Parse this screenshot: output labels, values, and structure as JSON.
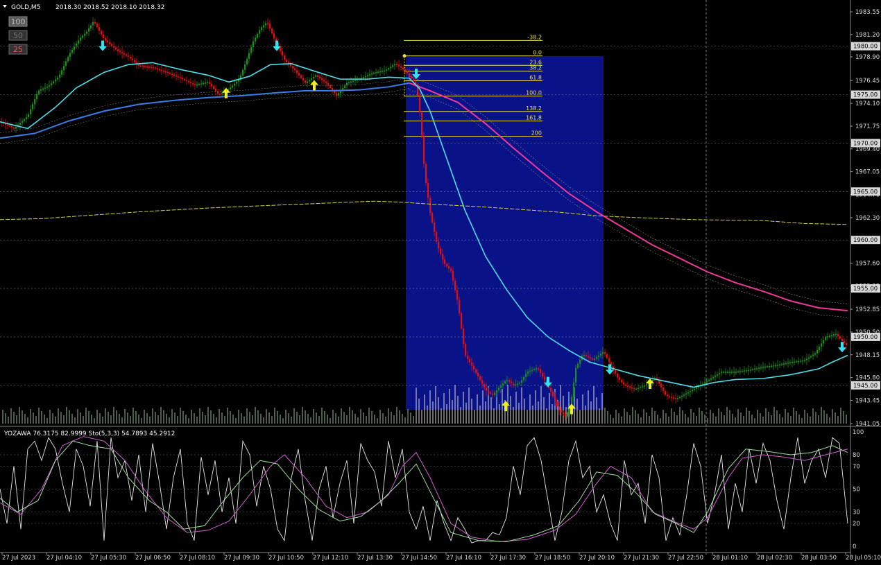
{
  "header": {
    "symbol": "GOLD,M5",
    "ohlc": "2018.30 2018.52 2018.10 2018.32"
  },
  "buttons": [
    "100",
    "50",
    "25"
  ],
  "colors": {
    "background": "#000000",
    "bull": "#1e8c1e",
    "bear": "#e01010",
    "ma_cyan": "#4fe0ee",
    "ma_blue": "#3a7ee8",
    "ma_pink": "#ee3a9a",
    "fib": "#f0e040",
    "rect": "#0a1288",
    "arrow_down": "#32e4f0",
    "arrow_up": "#f0f020",
    "grid": "#c8c8c8",
    "volume": "#9ab89a"
  },
  "price_axis": {
    "labels": [
      "1983.55",
      "1981.20",
      "1978.90",
      "1976.45",
      "1974.10",
      "1971.75",
      "1969.40",
      "1967.05",
      "1964.70",
      "1962.30",
      "1957.60",
      "1955.25",
      "1952.85",
      "1950.50",
      "1948.15",
      "1945.80",
      "1943.45",
      "1941.05"
    ],
    "marked_levels": [
      "1980.00",
      "1975.00",
      "1970.00",
      "1965.00",
      "1960.00",
      "1955.00",
      "1950.00",
      "1945.00"
    ]
  },
  "time_axis": [
    "27 Jul 2023",
    "27 Jul 04:10",
    "27 Jul 05:30",
    "27 Jul 06:50",
    "27 Jul 08:10",
    "27 Jul 09:30",
    "27 Jul 10:50",
    "27 Jul 12:10",
    "27 Jul 13:30",
    "27 Jul 14:50",
    "27 Jul 16:10",
    "27 Jul 17:30",
    "27 Jul 18:50",
    "27 Jul 20:10",
    "27 Jul 21:30",
    "27 Jul 22:50",
    "28 Jul 01:10",
    "28 Jul 02:30",
    "28 Jul 03:50",
    "28 Jul 05:10"
  ],
  "fibonacci": {
    "high": 1979.0,
    "low": 1974.85,
    "levels": [
      "-38.2",
      "0.0",
      "23.6",
      "38.2",
      "61.8",
      "100.0",
      "138.2",
      "161.8",
      "200"
    ]
  },
  "indicator": {
    "title": "YOZAWA 76.3175 82.9999  Sto(5,3,3) 54.7893 45.2912",
    "axis_labels": [
      "100",
      "80",
      "70",
      "50",
      "30",
      "20",
      "0"
    ]
  },
  "chart_data": {
    "type": "candlestick",
    "title": "GOLD,M5",
    "y_range": [
      1940.5,
      1985.0
    ],
    "indicator_range": [
      0,
      100
    ],
    "price_path": [
      [
        0,
        1972.2
      ],
      [
        20,
        1971.5
      ],
      [
        40,
        1972.8
      ],
      [
        55,
        1975.4
      ],
      [
        70,
        1975.9
      ],
      [
        85,
        1976.9
      ],
      [
        100,
        1979.2
      ],
      [
        115,
        1980.8
      ],
      [
        125,
        1981.5
      ],
      [
        135,
        1982.6
      ],
      [
        150,
        1980.7
      ],
      [
        170,
        1979.5
      ],
      [
        185,
        1978.9
      ],
      [
        200,
        1978.0
      ],
      [
        220,
        1977.8
      ],
      [
        240,
        1977.3
      ],
      [
        260,
        1976.7
      ],
      [
        280,
        1976.0
      ],
      [
        300,
        1976.3
      ],
      [
        315,
        1975.0
      ],
      [
        330,
        1975.6
      ],
      [
        345,
        1976.6
      ],
      [
        355,
        1978.5
      ],
      [
        365,
        1980.5
      ],
      [
        375,
        1981.8
      ],
      [
        385,
        1982.5
      ],
      [
        395,
        1980.8
      ],
      [
        410,
        1978.6
      ],
      [
        425,
        1977.5
      ],
      [
        440,
        1976.2
      ],
      [
        455,
        1977.0
      ],
      [
        470,
        1976.2
      ],
      [
        485,
        1974.9
      ],
      [
        500,
        1976.2
      ],
      [
        520,
        1976.7
      ],
      [
        540,
        1977.3
      ],
      [
        555,
        1977.5
      ],
      [
        570,
        1978.2
      ],
      [
        585,
        1977.4
      ],
      [
        600,
        1976.0
      ],
      [
        606,
        1972.6
      ],
      [
        612,
        1966.9
      ],
      [
        620,
        1962.8
      ],
      [
        630,
        1959.5
      ],
      [
        640,
        1957.6
      ],
      [
        650,
        1956.8
      ],
      [
        660,
        1953.5
      ],
      [
        670,
        1948.2
      ],
      [
        680,
        1947.0
      ],
      [
        690,
        1945.8
      ],
      [
        700,
        1944.5
      ],
      [
        710,
        1944.0
      ],
      [
        720,
        1944.8
      ],
      [
        730,
        1945.6
      ],
      [
        740,
        1945.0
      ],
      [
        750,
        1945.3
      ],
      [
        760,
        1946.4
      ],
      [
        775,
        1946.8
      ],
      [
        785,
        1945.5
      ],
      [
        795,
        1944.2
      ],
      [
        805,
        1942.5
      ],
      [
        815,
        1941.8
      ],
      [
        822,
        1942.8
      ],
      [
        830,
        1946.8
      ],
      [
        840,
        1948.2
      ],
      [
        855,
        1947.6
      ],
      [
        870,
        1948.5
      ],
      [
        880,
        1947.1
      ],
      [
        890,
        1945.8
      ],
      [
        900,
        1945.0
      ],
      [
        915,
        1944.6
      ],
      [
        930,
        1945.0
      ],
      [
        945,
        1945.8
      ],
      [
        960,
        1943.9
      ],
      [
        975,
        1943.6
      ],
      [
        990,
        1944.2
      ],
      [
        1005,
        1944.8
      ],
      [
        1020,
        1945.5
      ],
      [
        1040,
        1946.4
      ],
      [
        1060,
        1946.4
      ],
      [
        1080,
        1946.6
      ],
      [
        1100,
        1946.9
      ],
      [
        1120,
        1947.1
      ],
      [
        1140,
        1947.4
      ],
      [
        1160,
        1947.6
      ],
      [
        1175,
        1948.3
      ],
      [
        1190,
        1950.0
      ],
      [
        1205,
        1950.3
      ],
      [
        1215,
        1949.5
      ],
      [
        1222,
        1949.0
      ]
    ],
    "ma_fast_cyan": [
      [
        0,
        1972.2
      ],
      [
        40,
        1971.5
      ],
      [
        80,
        1973.7
      ],
      [
        110,
        1975.7
      ],
      [
        150,
        1977.3
      ],
      [
        185,
        1978.1
      ],
      [
        220,
        1978.3
      ],
      [
        260,
        1977.6
      ],
      [
        300,
        1977.0
      ],
      [
        330,
        1976.3
      ],
      [
        360,
        1976.9
      ],
      [
        390,
        1978.1
      ],
      [
        420,
        1978.2
      ],
      [
        450,
        1977.5
      ],
      [
        490,
        1976.6
      ],
      [
        530,
        1976.6
      ],
      [
        560,
        1976.8
      ],
      [
        590,
        1976.7
      ],
      [
        605,
        1975.6
      ],
      [
        620,
        1973.3
      ],
      [
        645,
        1968.2
      ],
      [
        670,
        1963.1
      ],
      [
        700,
        1958.3
      ],
      [
        730,
        1954.9
      ],
      [
        760,
        1952.0
      ],
      [
        790,
        1950.0
      ],
      [
        820,
        1948.6
      ],
      [
        850,
        1947.4
      ],
      [
        880,
        1946.8
      ],
      [
        920,
        1946.0
      ],
      [
        960,
        1945.4
      ],
      [
        1000,
        1944.8
      ],
      [
        1030,
        1945.3
      ],
      [
        1060,
        1945.6
      ],
      [
        1100,
        1945.7
      ],
      [
        1140,
        1946.1
      ],
      [
        1180,
        1946.7
      ],
      [
        1200,
        1947.4
      ],
      [
        1222,
        1948.1
      ]
    ],
    "ma_slow_blue": [
      [
        0,
        1970.5
      ],
      [
        50,
        1971.0
      ],
      [
        100,
        1972.3
      ],
      [
        150,
        1973.3
      ],
      [
        200,
        1974.0
      ],
      [
        250,
        1974.4
      ],
      [
        300,
        1974.7
      ],
      [
        350,
        1974.9
      ],
      [
        400,
        1975.2
      ],
      [
        440,
        1975.4
      ],
      [
        480,
        1975.4
      ],
      [
        520,
        1975.5
      ],
      [
        560,
        1975.8
      ],
      [
        590,
        1976.2
      ]
    ],
    "ma_pink": [
      [
        590,
        1976.2
      ],
      [
        620,
        1975.4
      ],
      [
        660,
        1974.2
      ],
      [
        700,
        1972.0
      ],
      [
        740,
        1969.5
      ],
      [
        780,
        1967.1
      ],
      [
        820,
        1964.8
      ],
      [
        860,
        1962.9
      ],
      [
        900,
        1961.2
      ],
      [
        940,
        1959.5
      ],
      [
        980,
        1958.1
      ],
      [
        1020,
        1956.7
      ],
      [
        1060,
        1955.6
      ],
      [
        1100,
        1954.7
      ],
      [
        1140,
        1953.7
      ],
      [
        1180,
        1953.0
      ],
      [
        1222,
        1952.7
      ]
    ],
    "ma_yellow_dashed": [
      [
        0,
        1962.1
      ],
      [
        60,
        1962.2
      ],
      [
        120,
        1962.5
      ],
      [
        200,
        1962.9
      ],
      [
        300,
        1963.3
      ],
      [
        400,
        1963.6
      ],
      [
        470,
        1963.8
      ],
      [
        500,
        1963.9
      ],
      [
        540,
        1964.0
      ],
      [
        580,
        1963.9
      ],
      [
        620,
        1963.7
      ],
      [
        700,
        1963.4
      ],
      [
        760,
        1963.1
      ],
      [
        800,
        1962.9
      ],
      [
        860,
        1962.5
      ],
      [
        920,
        1962.3
      ],
      [
        1000,
        1962.1
      ],
      [
        1100,
        1962.0
      ],
      [
        1160,
        1961.7
      ],
      [
        1222,
        1961.6
      ]
    ],
    "arrows_down": [
      [
        148,
        1980.0
      ],
      [
        399,
        1980.0
      ],
      [
        600,
        1977.1
      ],
      [
        790,
        1945.3
      ],
      [
        879,
        1946.6
      ],
      [
        1214,
        1948.9
      ]
    ],
    "arrows_up": [
      [
        326,
        1975.2
      ],
      [
        453,
        1976.0
      ],
      [
        729,
        1942.9
      ],
      [
        824,
        1942.6
      ],
      [
        937,
        1945.2
      ]
    ],
    "stoch_pink": [
      [
        0,
        38
      ],
      [
        30,
        28
      ],
      [
        60,
        50
      ],
      [
        90,
        88
      ],
      [
        120,
        96
      ],
      [
        150,
        92
      ],
      [
        180,
        75
      ],
      [
        210,
        48
      ],
      [
        240,
        25
      ],
      [
        270,
        12
      ],
      [
        300,
        14
      ],
      [
        330,
        22
      ],
      [
        360,
        45
      ],
      [
        390,
        70
      ],
      [
        410,
        80
      ],
      [
        440,
        60
      ],
      [
        470,
        35
      ],
      [
        500,
        25
      ],
      [
        530,
        30
      ],
      [
        560,
        45
      ],
      [
        580,
        70
      ],
      [
        600,
        82
      ],
      [
        620,
        60
      ],
      [
        650,
        20
      ],
      [
        680,
        8
      ],
      [
        720,
        4
      ],
      [
        760,
        6
      ],
      [
        800,
        14
      ],
      [
        830,
        28
      ],
      [
        860,
        55
      ],
      [
        880,
        70
      ],
      [
        910,
        60
      ],
      [
        940,
        30
      ],
      [
        970,
        22
      ],
      [
        1000,
        15
      ],
      [
        1020,
        25
      ],
      [
        1050,
        60
      ],
      [
        1070,
        77
      ],
      [
        1100,
        80
      ],
      [
        1130,
        78
      ],
      [
        1160,
        75
      ],
      [
        1190,
        80
      ],
      [
        1222,
        85
      ]
    ],
    "stoch_green": [
      [
        0,
        42
      ],
      [
        25,
        30
      ],
      [
        55,
        40
      ],
      [
        80,
        75
      ],
      [
        105,
        92
      ],
      [
        130,
        88
      ],
      [
        160,
        85
      ],
      [
        185,
        60
      ],
      [
        215,
        40
      ],
      [
        240,
        30
      ],
      [
        265,
        15
      ],
      [
        295,
        18
      ],
      [
        320,
        38
      ],
      [
        350,
        60
      ],
      [
        375,
        75
      ],
      [
        400,
        72
      ],
      [
        430,
        50
      ],
      [
        460,
        32
      ],
      [
        490,
        22
      ],
      [
        520,
        26
      ],
      [
        550,
        40
      ],
      [
        575,
        55
      ],
      [
        600,
        72
      ],
      [
        620,
        48
      ],
      [
        650,
        12
      ],
      [
        690,
        5
      ],
      [
        730,
        4
      ],
      [
        770,
        10
      ],
      [
        805,
        18
      ],
      [
        835,
        40
      ],
      [
        860,
        65
      ],
      [
        890,
        62
      ],
      [
        915,
        48
      ],
      [
        945,
        28
      ],
      [
        975,
        20
      ],
      [
        1000,
        12
      ],
      [
        1020,
        30
      ],
      [
        1050,
        68
      ],
      [
        1075,
        85
      ],
      [
        1105,
        83
      ],
      [
        1140,
        80
      ],
      [
        1170,
        82
      ],
      [
        1200,
        88
      ],
      [
        1222,
        82
      ]
    ],
    "yozawa_white": [
      [
        0,
        50
      ],
      [
        10,
        20
      ],
      [
        20,
        70
      ],
      [
        30,
        15
      ],
      [
        40,
        85
      ],
      [
        50,
        92
      ],
      [
        60,
        75
      ],
      [
        70,
        95
      ],
      [
        80,
        85
      ],
      [
        90,
        55
      ],
      [
        100,
        30
      ],
      [
        110,
        85
      ],
      [
        120,
        70
      ],
      [
        130,
        35
      ],
      [
        140,
        92
      ],
      [
        150,
        5
      ],
      [
        160,
        95
      ],
      [
        170,
        60
      ],
      [
        180,
        75
      ],
      [
        190,
        40
      ],
      [
        200,
        80
      ],
      [
        210,
        30
      ],
      [
        220,
        90
      ],
      [
        230,
        55
      ],
      [
        240,
        15
      ],
      [
        250,
        60
      ],
      [
        260,
        85
      ],
      [
        270,
        20
      ],
      [
        280,
        5
      ],
      [
        290,
        78
      ],
      [
        300,
        45
      ],
      [
        310,
        75
      ],
      [
        320,
        30
      ],
      [
        330,
        60
      ],
      [
        340,
        20
      ],
      [
        350,
        92
      ],
      [
        360,
        80
      ],
      [
        370,
        35
      ],
      [
        380,
        70
      ],
      [
        390,
        50
      ],
      [
        400,
        15
      ],
      [
        410,
        5
      ],
      [
        420,
        60
      ],
      [
        430,
        85
      ],
      [
        440,
        40
      ],
      [
        450,
        5
      ],
      [
        460,
        50
      ],
      [
        470,
        70
      ],
      [
        480,
        25
      ],
      [
        490,
        55
      ],
      [
        500,
        75
      ],
      [
        510,
        20
      ],
      [
        520,
        90
      ],
      [
        530,
        75
      ],
      [
        540,
        65
      ],
      [
        550,
        35
      ],
      [
        560,
        92
      ],
      [
        570,
        60
      ],
      [
        580,
        85
      ],
      [
        590,
        30
      ],
      [
        600,
        15
      ],
      [
        610,
        35
      ],
      [
        620,
        5
      ],
      [
        630,
        40
      ],
      [
        640,
        20
      ],
      [
        650,
        5
      ],
      [
        660,
        25
      ],
      [
        670,
        15
      ],
      [
        680,
        3
      ],
      [
        690,
        5
      ],
      [
        700,
        5
      ],
      [
        710,
        12
      ],
      [
        720,
        10
      ],
      [
        730,
        25
      ],
      [
        740,
        70
      ],
      [
        750,
        45
      ],
      [
        760,
        88
      ],
      [
        770,
        95
      ],
      [
        780,
        75
      ],
      [
        790,
        40
      ],
      [
        800,
        5
      ],
      [
        810,
        30
      ],
      [
        820,
        75
      ],
      [
        830,
        92
      ],
      [
        840,
        60
      ],
      [
        850,
        70
      ],
      [
        860,
        30
      ],
      [
        870,
        45
      ],
      [
        880,
        20
      ],
      [
        890,
        5
      ],
      [
        900,
        75
      ],
      [
        910,
        45
      ],
      [
        920,
        55
      ],
      [
        930,
        20
      ],
      [
        940,
        80
      ],
      [
        950,
        60
      ],
      [
        960,
        5
      ],
      [
        970,
        25
      ],
      [
        980,
        10
      ],
      [
        990,
        45
      ],
      [
        1000,
        90
      ],
      [
        1010,
        70
      ],
      [
        1020,
        20
      ],
      [
        1030,
        45
      ],
      [
        1040,
        80
      ],
      [
        1050,
        15
      ],
      [
        1060,
        55
      ],
      [
        1070,
        30
      ],
      [
        1080,
        85
      ],
      [
        1090,
        55
      ],
      [
        1100,
        90
      ],
      [
        1110,
        75
      ],
      [
        1120,
        40
      ],
      [
        1130,
        15
      ],
      [
        1140,
        60
      ],
      [
        1150,
        95
      ],
      [
        1160,
        55
      ],
      [
        1170,
        75
      ],
      [
        1180,
        85
      ],
      [
        1190,
        60
      ],
      [
        1200,
        95
      ],
      [
        1210,
        90
      ],
      [
        1222,
        20
      ]
    ]
  }
}
